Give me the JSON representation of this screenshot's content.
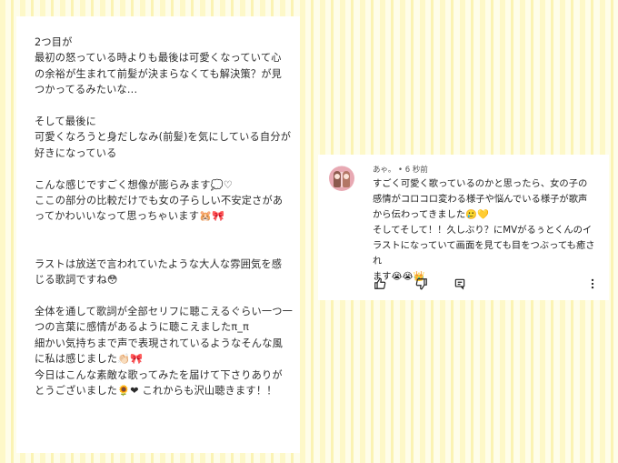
{
  "left_panel": {
    "text": "2つ目が\n最初の怒っている時よりも最後は可愛くなっていて心\nの余裕が生まれて前髪が決まらなくても解決策？が見\nつかってるみたいな...\n\nそして最後に\n可愛くなろうと身だしなみ(前髪)を気にしている自分が\n好きになっている\n\nこんな感じですごく想像が膨らみます💭♡\nここの部分の比較だけでも女の子らしい不安定さがあ\nってかわいいなって思っちゃいます🐹🎀\n\n\nラストは放送で言われていたような大人な雰囲気を感\nじる歌詞ですね😳\n\n全体を通して歌詞が全部セリフに聴こえるぐらい一つ一\nつの言葉に感情があるように聴こえましたπ_π\n細かい気持ちまで声で表現されているようなそんな風\nに私は感じました👏🏻🎀\n今日はこんな素敵な歌ってみたを届けて下さりありが\nとうございました🌻❤ これからも沢山聴きます！！"
  },
  "comment": {
    "author": "あゃ。",
    "time": "• 6 秒前",
    "text": "すごく可愛く歌っているのかと思ったら、女の子の\n感情がコロコロ変わる様子や悩んでいる様子が歌声\nから伝わってきました🥲💛\nそしてそして！！久しぶり？にMVがるぅとくんのイ\nラストになっていて画面を見ても目をつぶっても癒され\nます😭😭👑",
    "actions": [
      "thumb-up-icon",
      "thumb-down-icon",
      "reply-icon",
      "more-icon"
    ]
  },
  "colors": {
    "stripe_light": "#fefde9",
    "stripe_dark": "#fdf8c8",
    "panel": "#ffffff"
  }
}
